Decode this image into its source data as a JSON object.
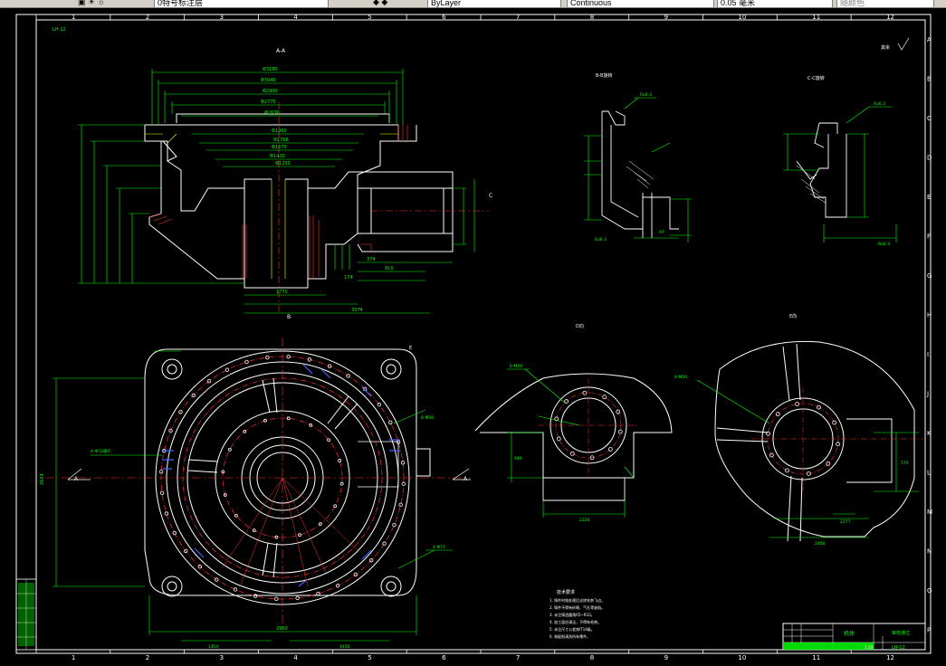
{
  "toolbar": {
    "layer_name": "0特号标注层",
    "layer_control": "ByLayer",
    "linetype": "Continuous",
    "lineweight": "0.05 毫米",
    "plot_style": "随颜色"
  },
  "frame": {
    "columns": [
      "1",
      "2",
      "3",
      "4",
      "5",
      "6",
      "7",
      "8",
      "9",
      "10",
      "11",
      "12"
    ],
    "rows": [
      "A",
      "B",
      "C",
      "D",
      "E",
      "F",
      "G",
      "H",
      "I",
      "J",
      "K",
      "L",
      "M",
      "N",
      "O",
      "P"
    ]
  },
  "views": {
    "section_aa": "A-A",
    "section_bb": "B-B旋转",
    "section_cc": "C-C旋转",
    "view_d": "D向",
    "view_e": "E向"
  },
  "labels": {
    "cut_a_left": "A",
    "cut_a_right": "A",
    "cut_b": "B",
    "cut_c": "C",
    "cut_e": "E",
    "doc_code": "LH-12",
    "roughness": "其余"
  },
  "dimensions": {
    "width_bottom": "2900",
    "height_left": "2624",
    "d_width": "2226",
    "e_width": "2460",
    "e_height": "2277",
    "aa_bottom": "1770",
    "aa_right": "3374"
  },
  "notes": {
    "title": "技术要求",
    "items": [
      "1. 铸件时效处理后去除毛刺飞边。",
      "2. 铸件不得有砂眼、气孔等缺陷。",
      "3. 未注铸造圆角R5~R10。",
      "4. 加工面应清洁，不得有毛刺。",
      "5. 未注尺寸公差按IT14级。",
      "6. 装配前清洗所有零件。"
    ]
  },
  "title_block": {
    "part_name": "机体",
    "drawing_no": "LH-12",
    "scale": "1:10"
  }
}
